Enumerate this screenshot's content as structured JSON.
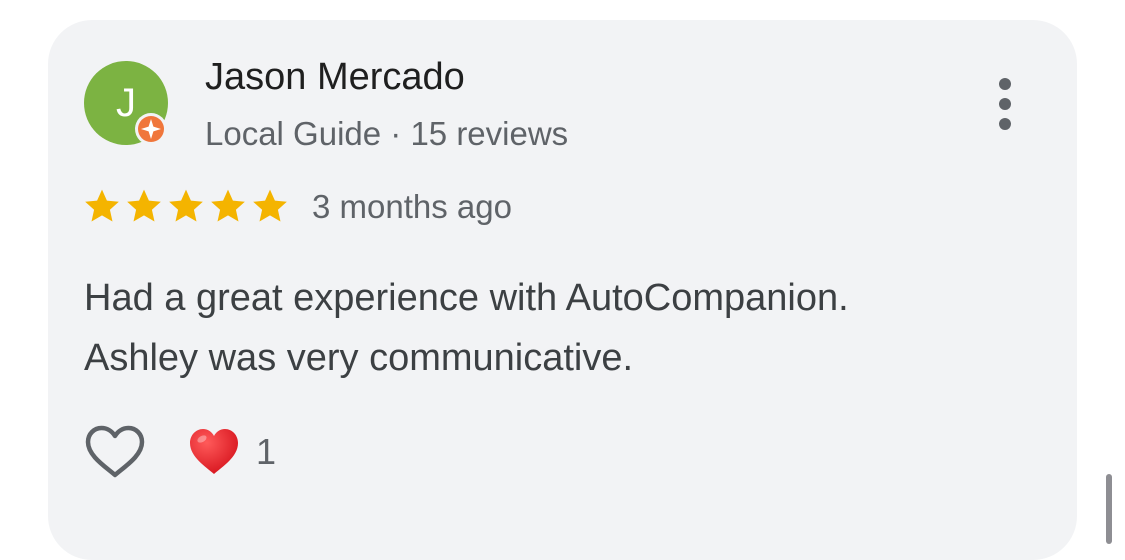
{
  "review": {
    "author": {
      "initial": "J",
      "name": "Jason Mercado",
      "meta": "Local Guide · 15 reviews",
      "avatar_color": "#7cb342",
      "badge_color": "#f0763b",
      "badge_icon": "local-guide-badge-icon"
    },
    "rating": 5,
    "rating_max": 5,
    "star_color": "#f4b400",
    "date": "3 months ago",
    "text_lines": [
      "Had a great experience with AutoCompanion.",
      "Ashley was very communicative."
    ],
    "reactions": {
      "like_icon": "heart-outline-icon",
      "heart_icon": "red-heart-icon",
      "count": "1"
    },
    "menu_icon": "more-vert-icon"
  }
}
